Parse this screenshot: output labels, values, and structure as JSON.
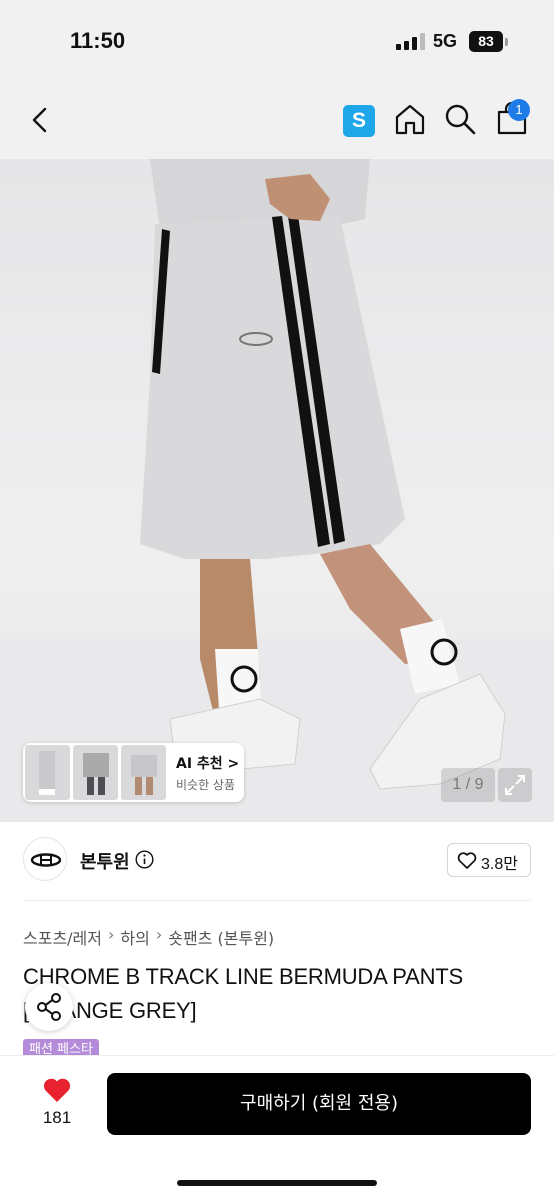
{
  "status_bar": {
    "time": "11:50",
    "network": "5G",
    "battery": "83"
  },
  "nav": {
    "s_badge": "S",
    "cart_count": "1",
    "icons": [
      "chevron-left-icon",
      "home-icon",
      "search-icon",
      "shopping-bag-icon"
    ],
    "accent_color": "#1ea7e8"
  },
  "gallery": {
    "ai_label": "AI 추천 >",
    "ai_sub": "비슷한 상품",
    "page_indicator": "1 / 9"
  },
  "shop": {
    "name": "본투윈",
    "likes": "3.8만"
  },
  "breadcrumb": [
    "스포츠/레저",
    "하의",
    "숏팬츠 (본투윈)"
  ],
  "product": {
    "title": "CHROME B TRACK LINE BERMUDA PANTS [ORANGE GREY]",
    "tag": "패션 페스타",
    "tag_color": "#b48bd8"
  },
  "bottom": {
    "wish_count": "181",
    "buy_label": "구매하기 (회원 전용)"
  }
}
